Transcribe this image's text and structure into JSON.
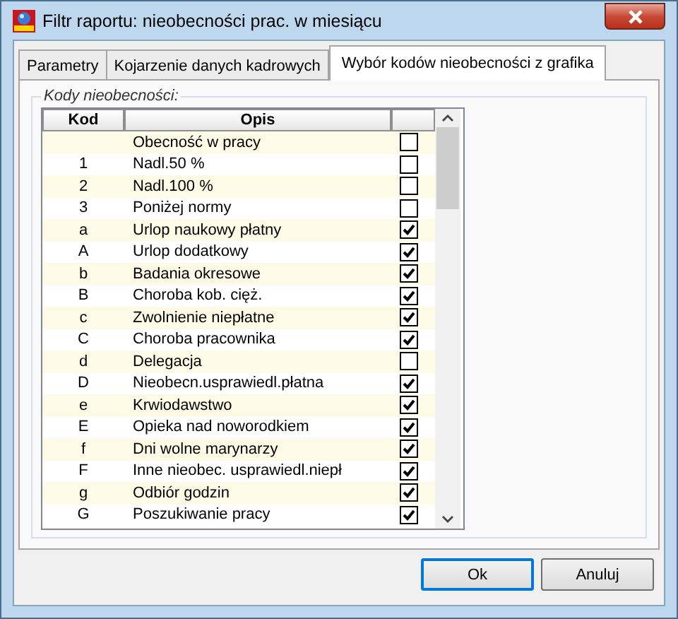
{
  "window": {
    "title": "Filtr raportu: nieobecności prac. w miesiącu"
  },
  "tabs": [
    {
      "label": "Parametry",
      "selected": false
    },
    {
      "label": "Kojarzenie danych kadrowych",
      "selected": false
    },
    {
      "label": "Wybór kodów nieobecności z grafika",
      "selected": true
    }
  ],
  "group": {
    "label": "Kody nieobecności:"
  },
  "table": {
    "columns": [
      "Kod",
      "Opis"
    ],
    "rows": [
      {
        "code": "",
        "description": "Obecność w pracy",
        "checked": false
      },
      {
        "code": "1",
        "description": "Nadl.50 %",
        "checked": false
      },
      {
        "code": "2",
        "description": "Nadl.100 %",
        "checked": false
      },
      {
        "code": "3",
        "description": "Poniżej normy",
        "checked": false
      },
      {
        "code": "a",
        "description": "Urlop naukowy płatny",
        "checked": true
      },
      {
        "code": "A",
        "description": "Urlop dodatkowy",
        "checked": true
      },
      {
        "code": "b",
        "description": "Badania okresowe",
        "checked": true
      },
      {
        "code": "B",
        "description": "Choroba kob. cięż.",
        "checked": true
      },
      {
        "code": "c",
        "description": "Zwolnienie niepłatne",
        "checked": true
      },
      {
        "code": "C",
        "description": "Choroba pracownika",
        "checked": true
      },
      {
        "code": "d",
        "description": "Delegacja",
        "checked": false
      },
      {
        "code": "D",
        "description": "Nieobecn.usprawiedl.płatna",
        "checked": true
      },
      {
        "code": "e",
        "description": "Krwiodawstwo",
        "checked": true
      },
      {
        "code": "E",
        "description": "Opieka nad noworodkiem",
        "checked": true
      },
      {
        "code": "f",
        "description": "Dni wolne marynarzy",
        "checked": true
      },
      {
        "code": "F",
        "description": "Inne nieobec. usprawiedl.niepł",
        "checked": true
      },
      {
        "code": "g",
        "description": "Odbiór godzin",
        "checked": true
      },
      {
        "code": "G",
        "description": "Poszukiwanie pracy",
        "checked": true
      }
    ]
  },
  "buttons": [
    {
      "label": "Ok",
      "kind": "default"
    },
    {
      "label": "Anuluj",
      "kind": "normal"
    }
  ]
}
